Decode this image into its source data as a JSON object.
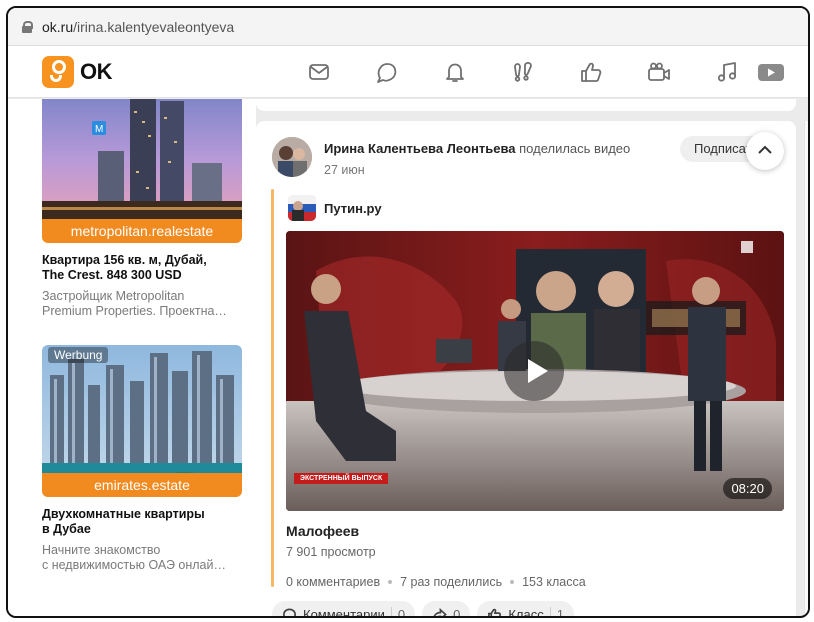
{
  "browser": {
    "url_host": "ok.ru",
    "url_path": "/irina.kalentyevaleontyeva"
  },
  "header": {
    "logo_text": "OK",
    "icons": [
      "mail-icon",
      "chat-icon",
      "bell-icon",
      "guests-icon",
      "like-icon",
      "video-camera-icon",
      "music-icon",
      "video-icon"
    ]
  },
  "ads": [
    {
      "brand": "metropolitan.realestate",
      "title_line1": "Квартира 156 кв. м, Дубай,",
      "title_line2": "The Crest. 848 300 USD",
      "desc_line1": "Застройщик Metropolitan",
      "desc_line2": "Premium Properties. Проектна…"
    },
    {
      "badge": "Werbung",
      "brand": "emirates.estate",
      "title_line1": "Двухкомнатные квартиры",
      "title_line2": "в Дубае",
      "desc_line1": "Начните знакомство",
      "desc_line2": "с недвижимостью ОАЭ онлай…"
    }
  ],
  "post": {
    "author": "Ирина Калентьева Леонтьева",
    "action": "поделилась видео",
    "date": "27 июн",
    "subscribe_label": "Подписать",
    "source_name": "Путин.ру",
    "video": {
      "duration": "08:20",
      "overlay_badge": "ЭКСТРЕННЫЙ ВЫПУСК",
      "title": "Малофеев",
      "views": "7 901 просмотр"
    },
    "stats": {
      "comments": "0 комментариев",
      "shares": "7 раз поделились",
      "likes": "153 класса"
    },
    "actions": {
      "comments_label": "Комментарии",
      "comments_count": "0",
      "share_count": "0",
      "like_label": "Класс",
      "like_count": "1"
    }
  },
  "colors": {
    "brand_orange": "#f7931e",
    "ad_strip": "#f18a1f",
    "repost_bar": "#f5b867"
  }
}
